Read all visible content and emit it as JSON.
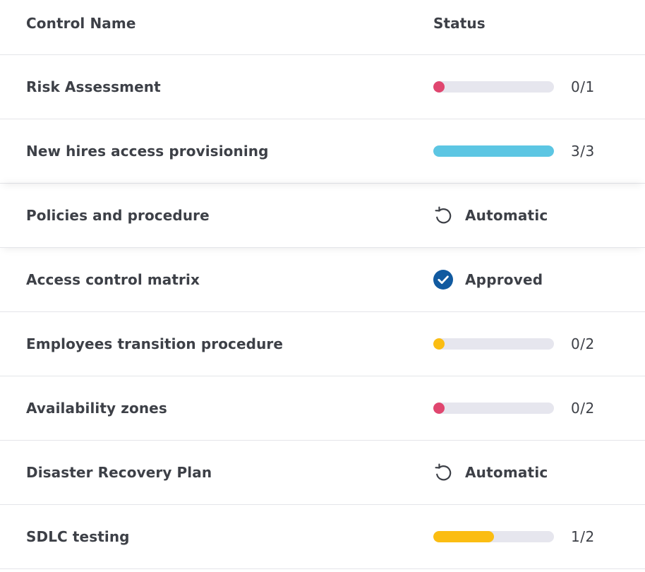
{
  "columns": {
    "name": "Control Name",
    "status": "Status"
  },
  "colors": {
    "red": "#e0466f",
    "blue": "#5cc6e3",
    "yellow": "#fbbd12",
    "approved": "#115aa0"
  },
  "rows": [
    {
      "name": "Risk Assessment",
      "status_type": "progress",
      "done": 0,
      "total": 1,
      "count": "0/1",
      "color": "#e0466f"
    },
    {
      "name": "New hires access provisioning",
      "status_type": "progress",
      "done": 3,
      "total": 3,
      "count": "3/3",
      "color": "#5cc6e3"
    },
    {
      "name": "Policies and procedure",
      "status_type": "icon",
      "icon": "refresh-icon",
      "label": "Automatic"
    },
    {
      "name": "Access control matrix",
      "status_type": "icon",
      "icon": "check-circle-icon",
      "label": "Approved"
    },
    {
      "name": "Employees transition procedure",
      "status_type": "progress",
      "done": 0,
      "total": 2,
      "count": "0/2",
      "color": "#fbbd12"
    },
    {
      "name": "Availability zones",
      "status_type": "progress",
      "done": 0,
      "total": 2,
      "count": "0/2",
      "color": "#e0466f"
    },
    {
      "name": "Disaster Recovery Plan",
      "status_type": "icon",
      "icon": "refresh-icon",
      "label": "Automatic"
    },
    {
      "name": "SDLC testing",
      "status_type": "progress",
      "done": 1,
      "total": 2,
      "count": "1/2",
      "color": "#fbbd12"
    }
  ]
}
